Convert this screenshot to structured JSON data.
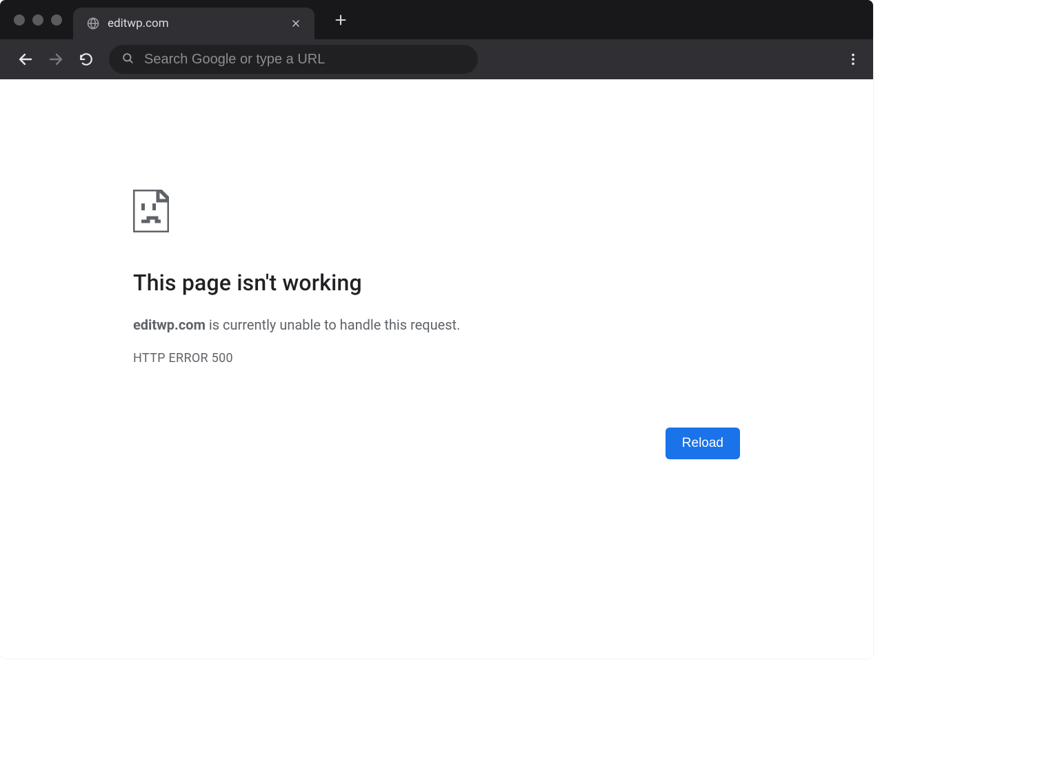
{
  "tab": {
    "title": "editwp.com"
  },
  "toolbar": {
    "omnibox_placeholder": "Search Google or type a URL"
  },
  "error": {
    "title": "This page isn't working",
    "host": "editwp.com",
    "desc_rest": " is currently unable to handle this request.",
    "code": "HTTP ERROR 500",
    "reload_label": "Reload"
  }
}
